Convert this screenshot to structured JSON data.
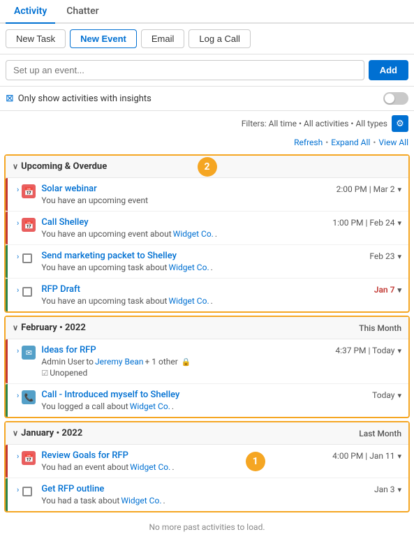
{
  "tabs": [
    {
      "id": "activity",
      "label": "Activity",
      "active": true
    },
    {
      "id": "chatter",
      "label": "Chatter",
      "active": false
    }
  ],
  "action_buttons": [
    {
      "id": "new-task",
      "label": "New Task",
      "primary": false
    },
    {
      "id": "new-event",
      "label": "New Event",
      "primary": true
    },
    {
      "id": "email",
      "label": "Email",
      "primary": false
    },
    {
      "id": "log-a-call",
      "label": "Log a Call",
      "primary": false
    }
  ],
  "event_setup": {
    "placeholder": "Set up an event...",
    "add_label": "Add"
  },
  "insights": {
    "label": "Only show activities with insights"
  },
  "filters": {
    "text": "Filters: All time • All activities • All types"
  },
  "links": {
    "refresh": "Refresh",
    "expand_all": "Expand All",
    "view_all": "View All"
  },
  "sections": [
    {
      "id": "upcoming-overdue",
      "title": "Upcoming & Overdue",
      "title_right": "",
      "badge": "2",
      "items": [
        {
          "id": "solar-webinar",
          "icon": "event",
          "title": "Solar webinar",
          "sub": "You have an upcoming event",
          "widget_link": null,
          "meta": "2:00 PM | Mar 2",
          "overdue": false,
          "border": "red"
        },
        {
          "id": "call-shelley",
          "icon": "event",
          "title": "Call Shelley",
          "sub": "You have an upcoming event about",
          "widget_link": "Widget Co.",
          "meta": "1:00 PM | Feb 24",
          "overdue": false,
          "border": "red"
        },
        {
          "id": "send-marketing",
          "icon": "task",
          "title": "Send marketing packet to Shelley",
          "sub": "You have an upcoming task about",
          "widget_link": "Widget Co.",
          "meta": "Feb 23",
          "overdue": false,
          "border": "green"
        },
        {
          "id": "rfp-draft",
          "icon": "task",
          "title": "RFP Draft",
          "sub": "You have an upcoming task about",
          "widget_link": "Widget Co.",
          "meta": "Jan 7",
          "overdue": true,
          "border": "green"
        }
      ]
    },
    {
      "id": "february-2022",
      "title": "February • 2022",
      "title_right": "This Month",
      "badge": null,
      "items": [
        {
          "id": "ideas-for-rfp",
          "icon": "email",
          "title": "Ideas for RFP",
          "sub_complex": true,
          "sub_from": "Admin User",
          "sub_to": "Jeremy Bean",
          "sub_others": "+ 1 other",
          "sub_lock": true,
          "sub_detail": "Unopened",
          "meta": "4:37 PM | Today",
          "overdue": false,
          "border": "red"
        },
        {
          "id": "call-introduced",
          "icon": "call",
          "title": "Call - Introduced myself to Shelley",
          "sub": "You logged a call about",
          "widget_link": "Widget Co.",
          "meta": "Today",
          "overdue": false,
          "border": "green"
        }
      ]
    },
    {
      "id": "january-2022",
      "title": "January • 2022",
      "title_right": "Last Month",
      "badge": "1",
      "items": [
        {
          "id": "review-goals",
          "icon": "event",
          "title": "Review Goals for RFP",
          "sub": "You had an event about",
          "widget_link": "Widget Co.",
          "meta": "4:00 PM | Jan 11",
          "overdue": false,
          "border": "red"
        },
        {
          "id": "get-rfp-outline",
          "icon": "task",
          "title": "Get RFP outline",
          "sub": "You had a task about",
          "widget_link": "Widget Co.",
          "meta": "Jan 3",
          "overdue": false,
          "border": "green"
        }
      ]
    }
  ],
  "footer": {
    "no_more": "No more past activities to load."
  }
}
